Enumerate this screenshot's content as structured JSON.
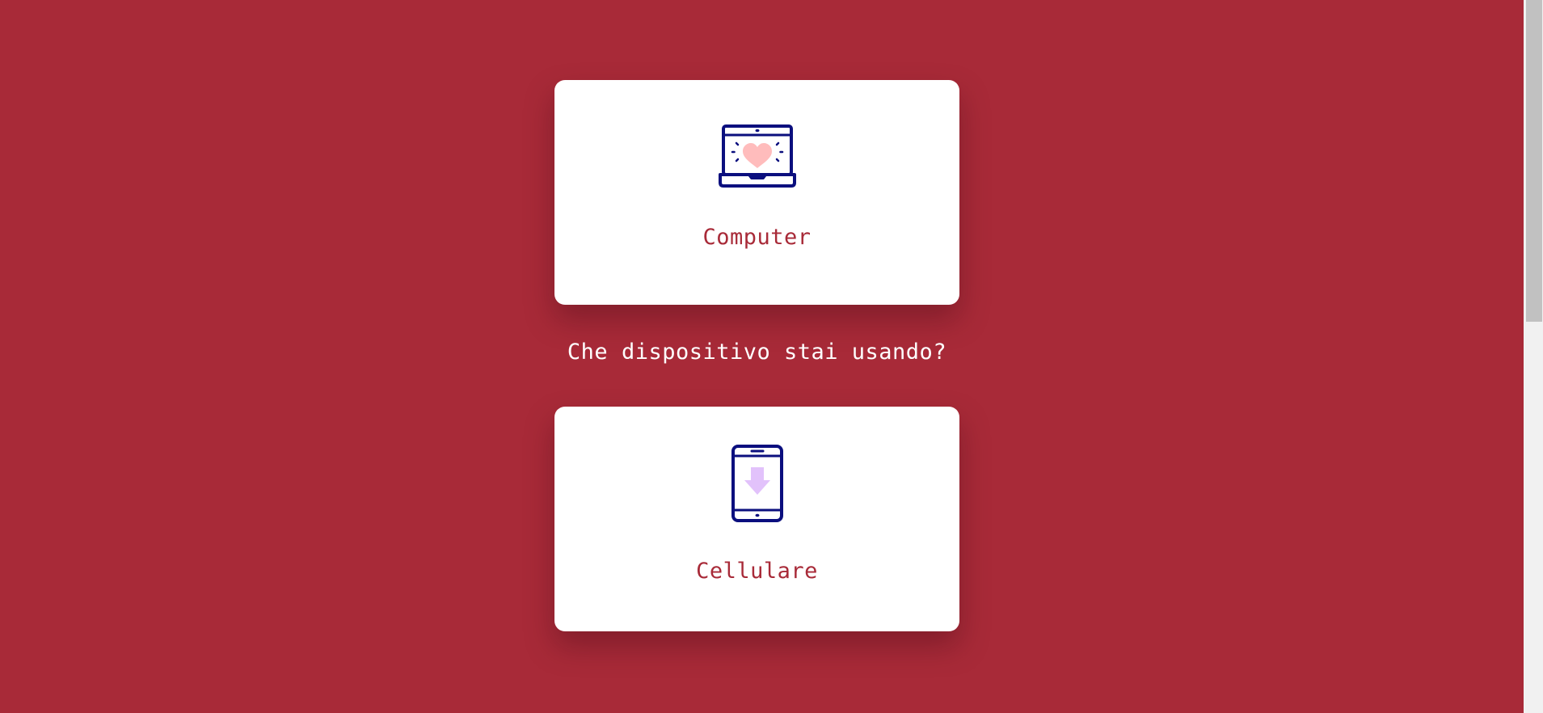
{
  "colors": {
    "background": "#a82a38",
    "card": "#ffffff",
    "accent_text": "#a82a38",
    "icon_stroke": "#0b0f7e",
    "heart": "#ffbcbc",
    "arrow": "#e2c2fb"
  },
  "options": [
    {
      "label": "Computer",
      "icon": "laptop-heart-icon"
    },
    {
      "label": "Cellulare",
      "icon": "smartphone-download-icon"
    }
  ],
  "prompt": "Che dispositivo stai usando?"
}
